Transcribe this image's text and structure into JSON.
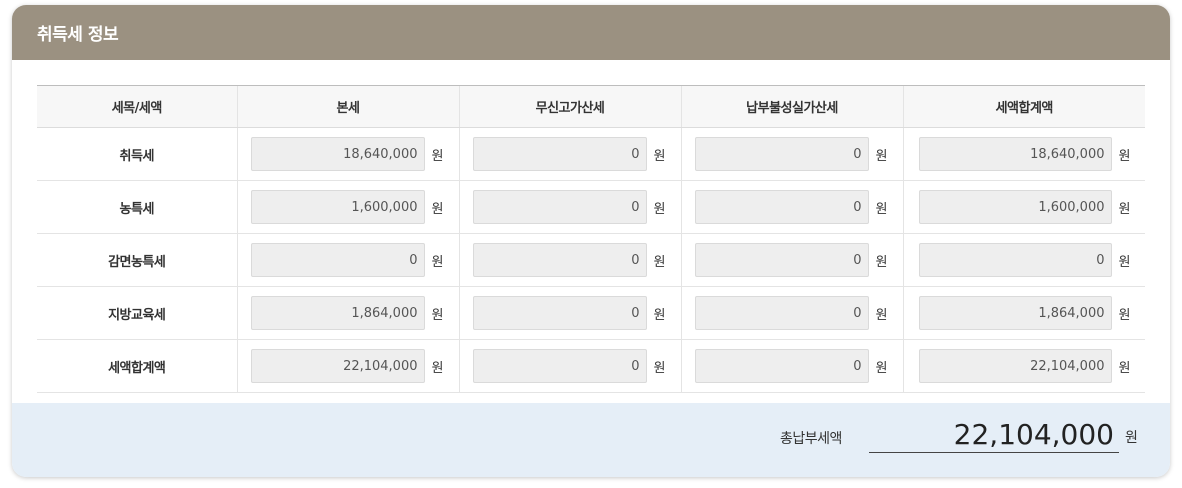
{
  "panel": {
    "title": "취득세 정보"
  },
  "table": {
    "headers": [
      "세목/세액",
      "본세",
      "무신고가산세",
      "납부불성실가산세",
      "세액합계액"
    ],
    "unit": "원",
    "rows": [
      {
        "label": "취득세",
        "values": [
          "18,640,000",
          "0",
          "0",
          "18,640,000"
        ]
      },
      {
        "label": "농특세",
        "values": [
          "1,600,000",
          "0",
          "0",
          "1,600,000"
        ]
      },
      {
        "label": "감면농특세",
        "values": [
          "0",
          "0",
          "0",
          "0"
        ]
      },
      {
        "label": "지방교육세",
        "values": [
          "1,864,000",
          "0",
          "0",
          "1,864,000"
        ]
      },
      {
        "label": "세액합계액",
        "values": [
          "22,104,000",
          "0",
          "0",
          "22,104,000"
        ]
      }
    ]
  },
  "total": {
    "label": "총납부세액",
    "value": "22,104,000",
    "unit": "원"
  },
  "colors": {
    "header_bg": "#9b9181",
    "footer_bg": "#e5eef7",
    "input_bg": "#eeeeee"
  }
}
